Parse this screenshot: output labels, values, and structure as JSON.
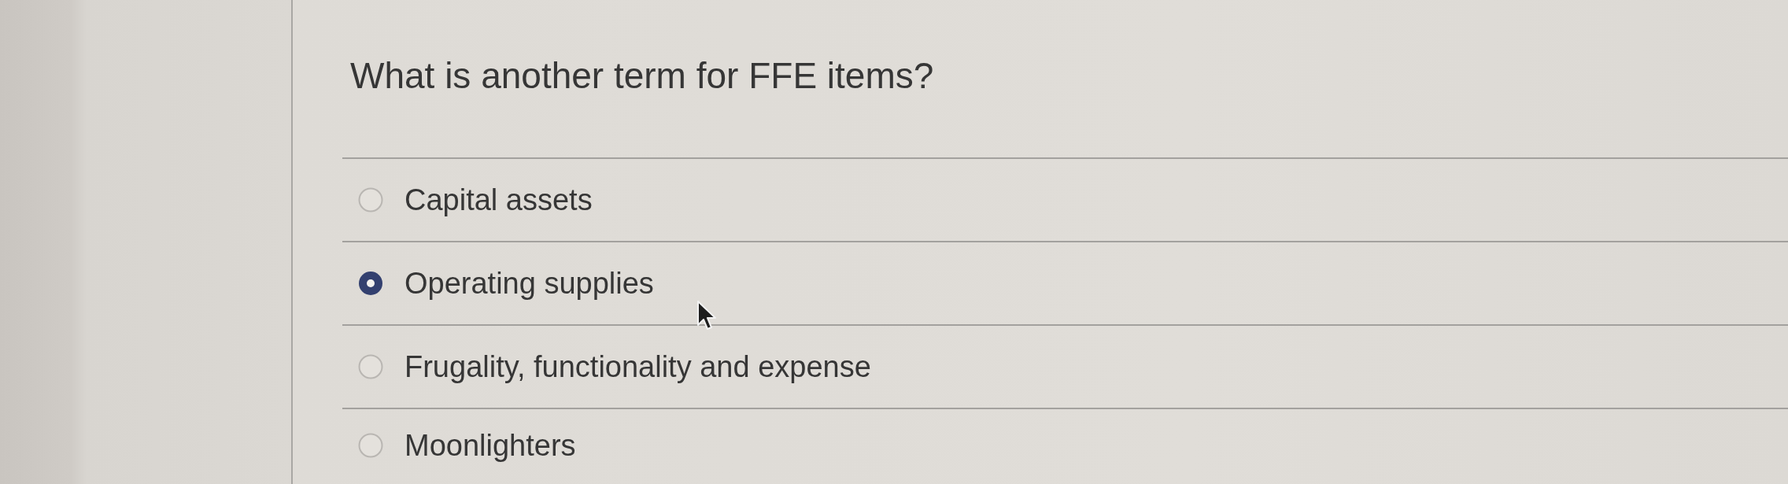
{
  "question": {
    "text": "What is another term for FFE items?"
  },
  "options": [
    {
      "label": "Capital assets",
      "selected": false
    },
    {
      "label": "Operating supplies",
      "selected": true
    },
    {
      "label": "Frugality, functionality and expense",
      "selected": false
    },
    {
      "label": "Moonlighters",
      "selected": false
    }
  ]
}
